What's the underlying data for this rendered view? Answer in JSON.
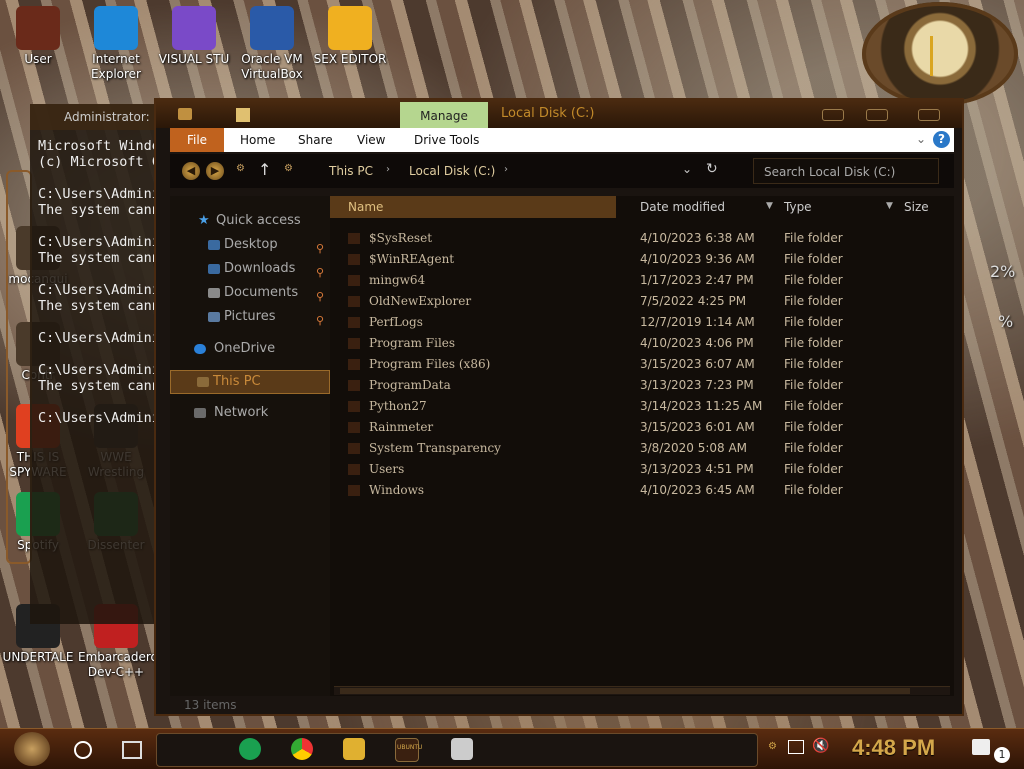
{
  "desktop": {
    "icons": [
      {
        "label": "User",
        "color": "#6a2a1a"
      },
      {
        "label": "Internet Explorer",
        "color": "#1e88d8"
      },
      {
        "label": "VISUAL STU",
        "color": "#7a4ac8"
      },
      {
        "label": "Oracle VM VirtualBox",
        "color": "#2a5aa8"
      },
      {
        "label": "SEX EDITOR",
        "color": "#f0b020"
      },
      {
        "label": "mocangui",
        "color": "#4a3a2a"
      },
      {
        "label": "Contr",
        "color": "#4a3a2a"
      },
      {
        "label": "THIS IS SPYWARE",
        "color": "#e04020"
      },
      {
        "label": "WWE Wrestling",
        "color": "#3a3a3a"
      },
      {
        "label": "Spotify",
        "color": "#1aa050"
      },
      {
        "label": "Dissenter",
        "color": "#1a9050"
      },
      {
        "label": "UNDERTALE",
        "color": "#222"
      },
      {
        "label": "Embarcadero Dev-C++",
        "color": "#c02020"
      }
    ],
    "percent_1": "2%",
    "percent_2": "%"
  },
  "cmd": {
    "title": "Administrator:",
    "lines": "Microsoft Window\n(c) Microsoft Co\n\nC:\\Users\\Admini\nThe system canno\n\nC:\\Users\\Admini\nThe system canno\n\nC:\\Users\\Admini\nThe system canno\n\nC:\\Users\\Admini\n\nC:\\Users\\Admini\nThe system canno\n\nC:\\Users\\Admini"
  },
  "explorer": {
    "window_title": "Local Disk (C:)",
    "manage_tab": "Manage",
    "ribbon_tabs": {
      "file": "File",
      "home": "Home",
      "share": "Share",
      "view": "View",
      "drive_tools": "Drive Tools"
    },
    "breadcrumb": {
      "this_pc": "This PC",
      "local_disk": "Local Disk (C:)"
    },
    "search_placeholder": "Search Local Disk (C:)",
    "nav": {
      "quick_access": "Quick access",
      "desktop": "Desktop",
      "downloads": "Downloads",
      "documents": "Documents",
      "pictures": "Pictures",
      "onedrive": "OneDrive",
      "this_pc": "This PC",
      "network": "Network"
    },
    "columns": {
      "name": "Name",
      "date": "Date modified",
      "type": "Type",
      "size": "Size"
    },
    "files": [
      {
        "name": "$SysReset",
        "date": "4/10/2023 6:38 AM",
        "type": "File folder"
      },
      {
        "name": "$WinREAgent",
        "date": "4/10/2023 9:36 AM",
        "type": "File folder"
      },
      {
        "name": "mingw64",
        "date": "1/17/2023 2:47 PM",
        "type": "File folder"
      },
      {
        "name": "OldNewExplorer",
        "date": "7/5/2022 4:25 PM",
        "type": "File folder"
      },
      {
        "name": "PerfLogs",
        "date": "12/7/2019 1:14 AM",
        "type": "File folder"
      },
      {
        "name": "Program Files",
        "date": "4/10/2023 4:06 PM",
        "type": "File folder"
      },
      {
        "name": "Program Files (x86)",
        "date": "3/15/2023 6:07 AM",
        "type": "File folder"
      },
      {
        "name": "ProgramData",
        "date": "3/13/2023 7:23 PM",
        "type": "File folder"
      },
      {
        "name": "Python27",
        "date": "3/14/2023 11:25 AM",
        "type": "File folder"
      },
      {
        "name": "Rainmeter",
        "date": "3/15/2023 6:01 AM",
        "type": "File folder"
      },
      {
        "name": "System Transparency",
        "date": "3/8/2020 5:08 AM",
        "type": "File folder"
      },
      {
        "name": "Users",
        "date": "3/13/2023 4:51 PM",
        "type": "File folder"
      },
      {
        "name": "Windows",
        "date": "4/10/2023 6:45 AM",
        "type": "File folder"
      }
    ],
    "status": "13 items"
  },
  "taskbar": {
    "time": "4:48 PM",
    "notification_count": "1",
    "ubuntu_label": "UBUNTU"
  }
}
